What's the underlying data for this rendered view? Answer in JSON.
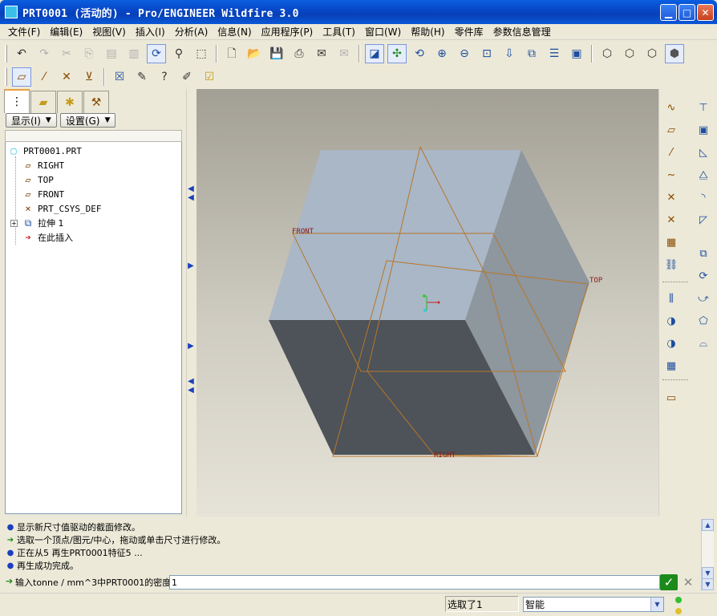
{
  "window": {
    "title": "PRT0001 (活动的) - Pro/ENGINEER Wildfire 3.0"
  },
  "menu": [
    {
      "label": "文件(F)"
    },
    {
      "label": "编辑(E)"
    },
    {
      "label": "视图(V)"
    },
    {
      "label": "插入(I)"
    },
    {
      "label": "分析(A)"
    },
    {
      "label": "信息(N)"
    },
    {
      "label": "应用程序(P)"
    },
    {
      "label": "工具(T)"
    },
    {
      "label": "窗口(W)"
    },
    {
      "label": "帮助(H)"
    },
    {
      "label": "零件库"
    },
    {
      "label": "参数信息管理"
    }
  ],
  "navigator": {
    "show_label": "显示(I)",
    "settings_label": "设置(G)",
    "tree": [
      {
        "label": "PRT0001.PRT",
        "icon": "part-icon"
      },
      {
        "label": "RIGHT",
        "icon": "datum-plane-icon"
      },
      {
        "label": "TOP",
        "icon": "datum-plane-icon"
      },
      {
        "label": "FRONT",
        "icon": "datum-plane-icon"
      },
      {
        "label": "PRT_CSYS_DEF",
        "icon": "csys-icon"
      },
      {
        "label": "拉伸 1",
        "icon": "extrude-icon"
      },
      {
        "label": "在此插入",
        "icon": "insert-here-arrow-icon"
      }
    ]
  },
  "graphics": {
    "labels": {
      "front": "FRONT",
      "top": "TOP",
      "right": "RIGHT"
    }
  },
  "messages": [
    {
      "bullet": "dot",
      "text": "显示新尺寸值驱动的截面修改。"
    },
    {
      "bullet": "arrow",
      "text": "选取一个顶点/图元/中心，拖动或单击尺寸进行修改。"
    },
    {
      "bullet": "dot",
      "text": "正在从5 再生PRT0001特征5 ..."
    },
    {
      "bullet": "dot",
      "text": "再生成功完成。"
    }
  ],
  "input": {
    "prompt": "输入tonne / mm^3中PRT0001的密度",
    "value": "1"
  },
  "status": {
    "selected": "选取了1",
    "filter": "智能"
  },
  "colors": {
    "titlebar": "#0a5fe0",
    "datum": "#b8762a",
    "top_face": "#a9b7c6",
    "right_face": "#8e969e",
    "front_face": "#4d5358",
    "confirm": "#1b8a1b"
  }
}
